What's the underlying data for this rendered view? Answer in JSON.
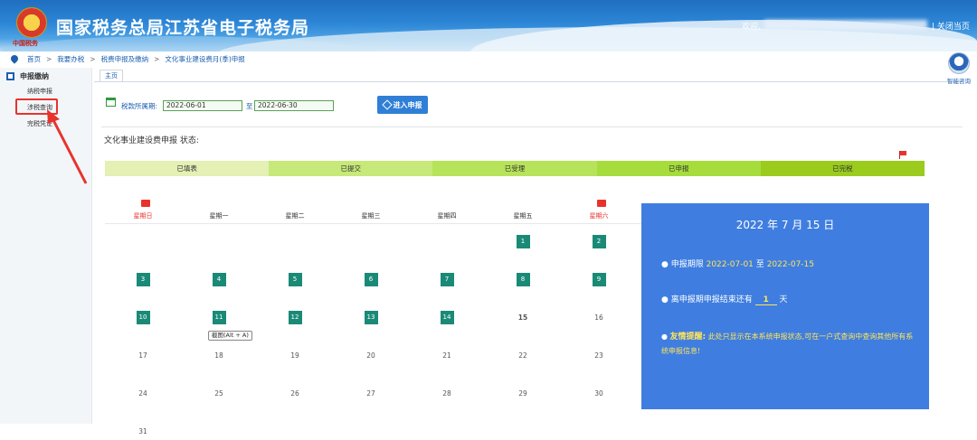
{
  "header": {
    "site_title": "国家税务总局江苏省电子税务局",
    "emblem_text": "中国税务",
    "welcome": "欢迎,",
    "close_page": "| 关闭当页"
  },
  "breadcrumb": [
    "首页",
    "我要办税",
    "税费申报及缴纳",
    "文化事业建设费月(季)申报"
  ],
  "breadcrumb_sep": ">",
  "sidebar": {
    "heading": "申报缴纳",
    "items": [
      "纳税申报",
      "涉税查询",
      "完税凭证"
    ]
  },
  "tab": "主页",
  "helper": "智能咨询",
  "period": {
    "label": "税款所属期:",
    "start": "2022-06-01",
    "to": "至",
    "end": "2022-06-30",
    "button": "进入申报"
  },
  "status_title": "文化事业建设费申报 状态:",
  "status_steps": [
    "已填表",
    "已提交",
    "已受理",
    "已申报",
    "已完税"
  ],
  "status_colors": [
    "#e4f0b4",
    "#c7e979",
    "#b7e35a",
    "#a6dd3c",
    "#9acb1d"
  ],
  "calendar": {
    "weekdays": [
      "星期日",
      "星期一",
      "星期二",
      "星期三",
      "星期四",
      "星期五",
      "星期六"
    ],
    "days": [
      {
        "d": "1",
        "s": "filed"
      },
      {
        "d": "2",
        "s": "filed"
      },
      {
        "d": "3",
        "s": "filed"
      },
      {
        "d": "4",
        "s": "filed"
      },
      {
        "d": "5",
        "s": "filed"
      },
      {
        "d": "6",
        "s": "filed"
      },
      {
        "d": "7",
        "s": "filed"
      },
      {
        "d": "8",
        "s": "filed"
      },
      {
        "d": "9",
        "s": "filed"
      },
      {
        "d": "10",
        "s": "filed"
      },
      {
        "d": "11",
        "s": "filed"
      },
      {
        "d": "12",
        "s": "filed"
      },
      {
        "d": "13",
        "s": "filed"
      },
      {
        "d": "14",
        "s": "filed"
      },
      {
        "d": "15",
        "s": "today"
      },
      {
        "d": "16",
        "s": "plain"
      },
      {
        "d": "17",
        "s": "plain"
      },
      {
        "d": "18",
        "s": "plain"
      },
      {
        "d": "19",
        "s": "plain"
      },
      {
        "d": "20",
        "s": "plain"
      },
      {
        "d": "21",
        "s": "plain"
      },
      {
        "d": "22",
        "s": "plain"
      },
      {
        "d": "23",
        "s": "plain"
      },
      {
        "d": "24",
        "s": "plain"
      },
      {
        "d": "25",
        "s": "plain"
      },
      {
        "d": "26",
        "s": "plain"
      },
      {
        "d": "27",
        "s": "plain"
      },
      {
        "d": "28",
        "s": "plain"
      },
      {
        "d": "29",
        "s": "plain"
      },
      {
        "d": "30",
        "s": "plain"
      },
      {
        "d": "31",
        "s": "plain"
      }
    ],
    "tooltip": "截图(Alt + A)"
  },
  "info": {
    "date": "2022 年 7 月 15 日",
    "deadline_label": "申报期限",
    "deadline_start": "2022-07-01",
    "deadline_to": "至",
    "deadline_end": "2022-07-15",
    "remaining_prefix": "离申报期申报结束还有",
    "remaining_days": "1",
    "remaining_suffix": "天",
    "reminder_label": "友情提醒:",
    "reminder_text": "此处只显示在本系统申报状态,可在一户式查询中查询其他所有系统申报信息!"
  }
}
